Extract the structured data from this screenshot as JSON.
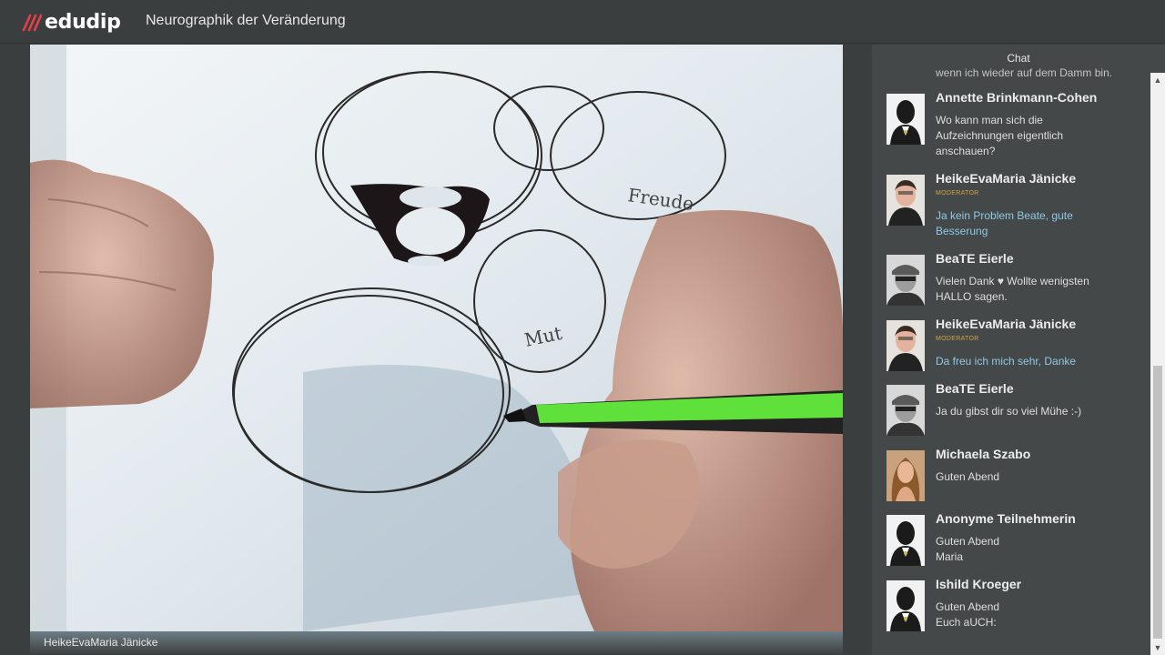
{
  "header": {
    "logo_text": "edudip",
    "title": "Neurographik der Veränderung"
  },
  "video": {
    "presenter_name": "HeikeEvaMaria Jänicke",
    "drawing_labels": [
      "Freude",
      "Mut"
    ]
  },
  "chat": {
    "title": "Chat",
    "partial_message": "wenn ich wieder auf dem Damm bin.",
    "messages": [
      {
        "author": "Annette Brinkmann-Cohen",
        "role": "",
        "lines": [
          "Wo kann man sich die",
          "Aufzeichnungen eigentlich",
          "anschauen?"
        ],
        "avatar": "default-avatar-icon"
      },
      {
        "author": "HeikeEvaMaria Jänicke",
        "role": "MODERATOR",
        "lines": [
          "Ja kein Problem Beate, gute",
          "Besserung"
        ],
        "avatar": "moderator-photo"
      },
      {
        "author": "BeaTE Eierle",
        "role": "",
        "lines": [
          "Vielen Dank ♥ Wollte wenigsten",
          "HALLO sagen."
        ],
        "avatar": "user-photo"
      },
      {
        "author": "HeikeEvaMaria Jänicke",
        "role": "MODERATOR",
        "lines": [
          "Da freu ich mich sehr, Danke"
        ],
        "avatar": "moderator-photo"
      },
      {
        "author": "BeaTE Eierle",
        "role": "",
        "lines": [
          "Ja du gibst dir so viel Mühe :-)"
        ],
        "avatar": "user-photo"
      },
      {
        "author": "Michaela Szabo",
        "role": "",
        "lines": [
          "Guten Abend"
        ],
        "avatar": "user-photo"
      },
      {
        "author": "Anonyme Teilnehmerin",
        "role": "",
        "lines": [
          "Guten Abend",
          "Maria"
        ],
        "avatar": "default-avatar-icon"
      },
      {
        "author": "Ishild Kroeger",
        "role": "",
        "lines": [
          "Guten Abend",
          "Euch aUCH:"
        ],
        "avatar": "default-avatar-icon"
      }
    ]
  },
  "colors": {
    "background": "#3b3e3f",
    "chat_background": "#454849",
    "moderator_text": "#8ec9e6",
    "moderator_badge": "#d5a439",
    "brand_red": "#e5404a"
  }
}
